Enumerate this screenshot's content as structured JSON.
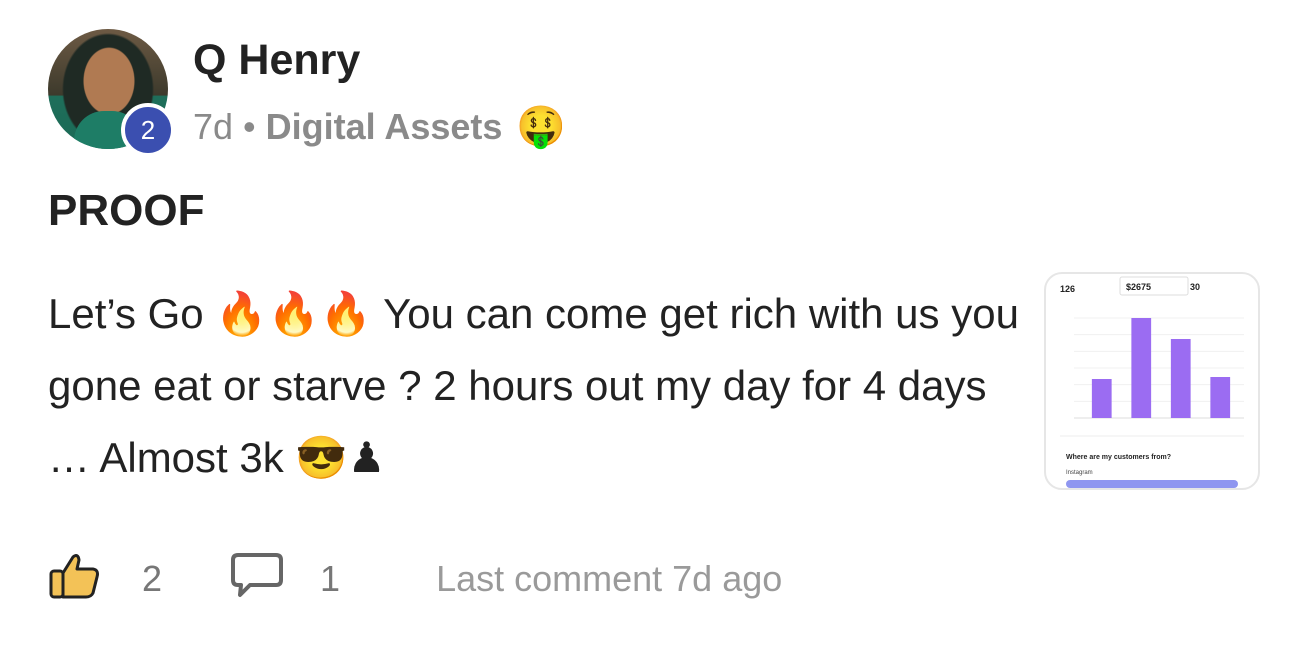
{
  "post": {
    "author": "Q Henry",
    "level": "2",
    "time": "7d",
    "separator": "•",
    "category": "Digital Assets",
    "category_emoji": "🤑",
    "title": "PROOF",
    "body": "Let’s Go 🔥🔥🔥 You can come get rich with us you gone eat or starve ? 2 hours out my day for 4 days … Almost 3k 😎♟"
  },
  "actions": {
    "like_icon": "thumbs-up-icon",
    "like_count": "2",
    "comment_icon": "comment-bubble-icon",
    "comment_count": "1",
    "last_comment": "Last comment 7d ago"
  },
  "thumbnail": {
    "stats": [
      "126",
      "$2675",
      "30"
    ],
    "section_title": "Where are my customers from?",
    "source_label": "Instagram",
    "bar_color": "#9b6cf2",
    "chart_data": {
      "type": "bar",
      "values": [
        390,
        1000,
        790,
        410
      ]
    }
  },
  "colors": {
    "badge": "#3b4fb0",
    "text": "#222222",
    "muted": "#8a8a8a"
  }
}
